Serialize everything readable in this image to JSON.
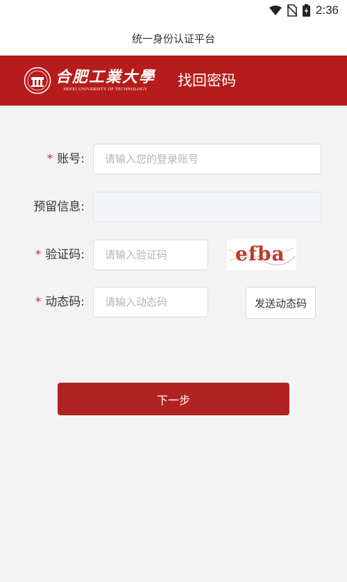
{
  "status_bar": {
    "time": "2:36",
    "icons": [
      "wifi-icon",
      "no-sim-icon",
      "battery-charging-icon"
    ]
  },
  "app": {
    "title": "统一身份认证平台"
  },
  "header": {
    "logo_cn": "合肥工業大學",
    "logo_en": "HEFEI UNIVERSITY OF TECHNOLOGY",
    "page_title": "找回密码"
  },
  "form": {
    "required_mark": "*",
    "account": {
      "label": "账号:",
      "placeholder": "请输入您的登录账号"
    },
    "reserved_info": {
      "label": "预留信息:"
    },
    "captcha": {
      "label": "验证码:",
      "placeholder": "请输入验证码",
      "image_text": "efba"
    },
    "sms_code": {
      "label": "动态码:",
      "placeholder": "请输入动态码",
      "send_label": "发送动态码"
    },
    "next_label": "下一步"
  },
  "colors": {
    "brand": "#b71c1c",
    "button": "#b22222",
    "required": "#c62828",
    "background": "#f3f3f3"
  }
}
